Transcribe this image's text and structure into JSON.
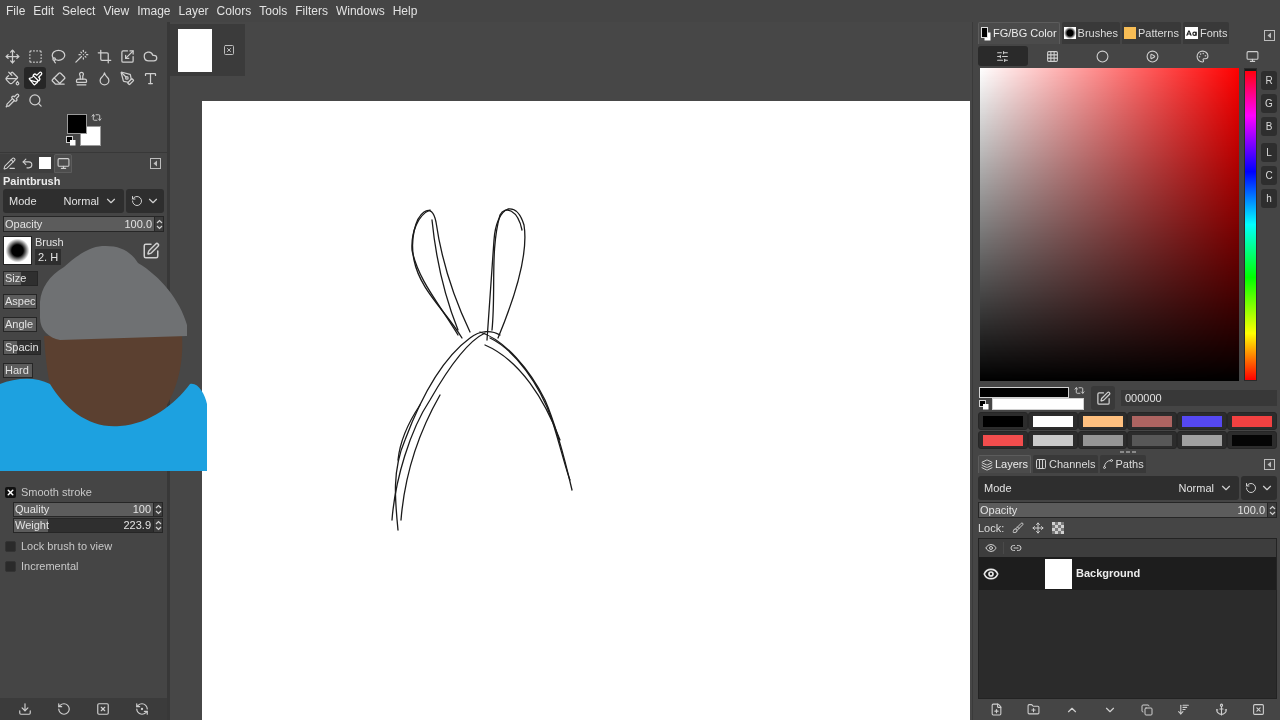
{
  "menu": [
    "File",
    "Edit",
    "Select",
    "View",
    "Image",
    "Layer",
    "Colors",
    "Tools",
    "Filters",
    "Windows",
    "Help"
  ],
  "toolbox": {
    "tool_rows": [
      [
        {
          "kind": "move",
          "selected": false
        },
        {
          "kind": "rect_select",
          "selected": false
        },
        {
          "kind": "lasso",
          "selected": false
        },
        {
          "kind": "fuzzy_select",
          "selected": false
        },
        {
          "kind": "crop",
          "selected": false
        },
        {
          "kind": "transform",
          "selected": false
        },
        {
          "kind": "warp",
          "selected": false
        }
      ],
      [
        {
          "kind": "bucket_fill",
          "selected": false
        },
        {
          "kind": "paintbrush",
          "selected": true
        },
        {
          "kind": "eraser",
          "selected": false
        },
        {
          "kind": "clone",
          "selected": false
        },
        {
          "kind": "smudge",
          "selected": false
        },
        {
          "kind": "paths",
          "selected": false
        },
        {
          "kind": "text",
          "selected": false
        }
      ],
      [
        {
          "kind": "color_picker",
          "selected": false
        },
        {
          "kind": "zoom",
          "selected": false
        }
      ]
    ],
    "colors": [
      {
        "kind": "foreground",
        "color": "#000000"
      },
      {
        "kind": "background",
        "color": "#ffffff"
      }
    ]
  },
  "tool_options": {
    "tabs": [
      {
        "kind": "tool_options",
        "selected": false
      },
      {
        "kind": "undo_history",
        "selected": false
      },
      {
        "kind": "images",
        "selected": false
      },
      {
        "kind": "device_status",
        "selected": true
      }
    ],
    "title": "Paintbrush",
    "mode": {
      "label": "Mode",
      "value": "Normal"
    },
    "opacity": {
      "label": "Opacity",
      "value": "100.0",
      "level": 1
    },
    "brush": {
      "label": "Brush",
      "value": "2. H"
    },
    "sliders": [
      {
        "label": "Size",
        "level": 0.5
      },
      {
        "label": "Aspec",
        "level": 1
      },
      {
        "label": "Angle",
        "level": 1
      },
      {
        "label": "Spacin",
        "level": 0.37
      },
      {
        "label": "Hard",
        "level": 1
      }
    ],
    "options": [
      {
        "kind": "checkbox",
        "label": "Smooth stroke",
        "checked": true,
        "children": [
          {
            "kind": "slider",
            "label": "Quality",
            "value": "100",
            "level": 1
          },
          {
            "kind": "slider",
            "label": "Weight",
            "value": "223.9",
            "level": 0.23
          }
        ]
      },
      {
        "kind": "checkbox",
        "label": "Lock brush to view",
        "checked": false
      },
      {
        "kind": "checkbox",
        "label": "Incremental",
        "checked": false
      }
    ]
  },
  "fg_bg_dock": {
    "tabs": [
      {
        "kind": "fg_bg",
        "label": "FG/BG Color",
        "selected": true
      },
      {
        "kind": "brushes",
        "label": "Brushes",
        "selected": false
      },
      {
        "kind": "patterns",
        "label": "Patterns",
        "selected": false
      },
      {
        "kind": "fonts",
        "label": "Fonts",
        "selected": false
      }
    ],
    "modes": [
      {
        "kind": "scales",
        "selected": true
      },
      {
        "kind": "cmyk",
        "selected": false
      },
      {
        "kind": "water",
        "selected": false
      },
      {
        "kind": "wheel",
        "selected": false
      },
      {
        "kind": "palette",
        "selected": false
      },
      {
        "kind": "screen",
        "selected": false
      }
    ],
    "hue": {
      "level": 0
    },
    "channels": [
      [
        "R",
        "G",
        "B"
      ],
      [
        "L",
        "C",
        "h"
      ]
    ],
    "colors": [
      {
        "kind": "foreground",
        "color": "#000000"
      },
      {
        "kind": "background",
        "color": "#ffffff"
      }
    ],
    "hex": "000000",
    "palette": [
      {
        "color": "#000000"
      },
      {
        "color": "#ffffff"
      },
      {
        "color": "#ffc07f"
      },
      {
        "color": "#ad6461"
      },
      {
        "color": "#5548f2"
      },
      {
        "color": "#f24141"
      },
      {
        "color": "#f24d4d"
      },
      {
        "color": "#cacaca"
      },
      {
        "color": "#959595"
      },
      {
        "color": "#575757"
      },
      {
        "color": "#a0a0a0"
      },
      {
        "color": "#050505"
      }
    ]
  },
  "layers_dock": {
    "tabs": [
      {
        "kind": "layers",
        "label": "Layers",
        "selected": true
      },
      {
        "kind": "channels",
        "label": "Channels",
        "selected": false
      },
      {
        "kind": "paths",
        "label": "Paths",
        "selected": false
      }
    ],
    "mode": {
      "label": "Mode",
      "value": "Normal"
    },
    "opacity": {
      "label": "Opacity",
      "value": "100.0",
      "level": 1
    },
    "lock_label": "Lock:",
    "layers": [
      {
        "name": "Background",
        "visible": true,
        "selected": true
      }
    ]
  }
}
